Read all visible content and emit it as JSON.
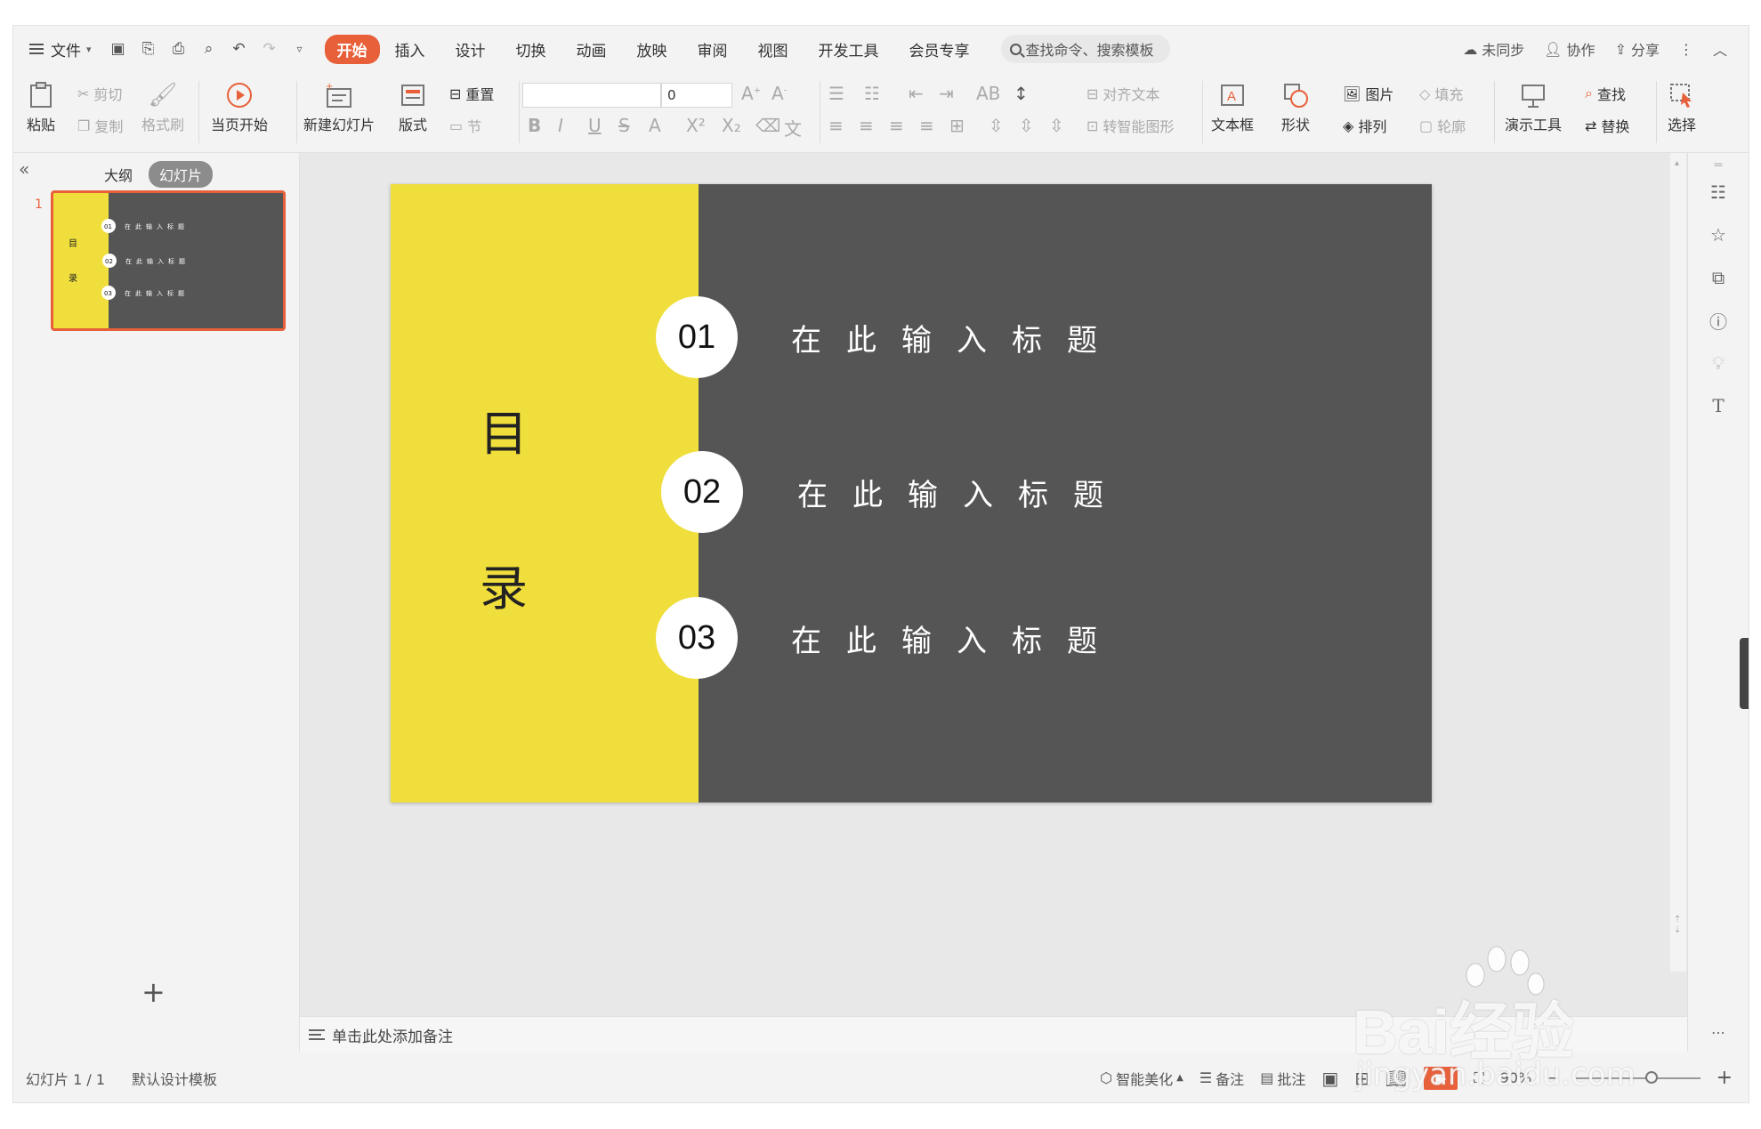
{
  "menu": {
    "file_label": "文件",
    "tabs": [
      "开始",
      "插入",
      "设计",
      "切换",
      "动画",
      "放映",
      "审阅",
      "视图",
      "开发工具",
      "会员专享"
    ],
    "active_tab": "开始",
    "search_placeholder": "查找命令、搜索模板",
    "right_items": {
      "sync": "未同步",
      "collab": "协作",
      "share": "分享"
    }
  },
  "ribbon": {
    "paste": "粘贴",
    "cut": "剪切",
    "copy": "复制",
    "format_painter": "格式刷",
    "play_from_current": "当页开始",
    "new_slide": "新建幻灯片",
    "layout": "版式",
    "reset": "重置",
    "section": "节",
    "font_size_value": "0",
    "align_text": "对齐文本",
    "smartart": "转智能图形",
    "textbox": "文本框",
    "shape": "形状",
    "picture": "图片",
    "fill": "填充",
    "arrange": "排列",
    "outline": "轮廓",
    "present_tools": "演示工具",
    "find": "查找",
    "replace": "替换",
    "select": "选择"
  },
  "left_panel": {
    "tab_outline": "大纲",
    "tab_slides": "幻灯片",
    "slide_number": "1"
  },
  "slide": {
    "char_top": "目",
    "char_bottom": "录",
    "items": [
      {
        "num": "01",
        "title": "在此输入标题"
      },
      {
        "num": "02",
        "title": "在此输入标题"
      },
      {
        "num": "03",
        "title": "在此输入标题"
      }
    ]
  },
  "notes_placeholder": "单击此处添加备注",
  "status": {
    "slide_count": "幻灯片 1 / 1",
    "template": "默认设计模板",
    "beautify": "智能美化",
    "notes": "备注",
    "comments": "批注",
    "zoom": "90%"
  },
  "watermark": {
    "main": "Bai经验",
    "url": "jingyan.baidu.com"
  },
  "colors": {
    "accent": "#e8603a",
    "slide_yellow": "#f0de3c",
    "slide_gray": "#555555"
  }
}
